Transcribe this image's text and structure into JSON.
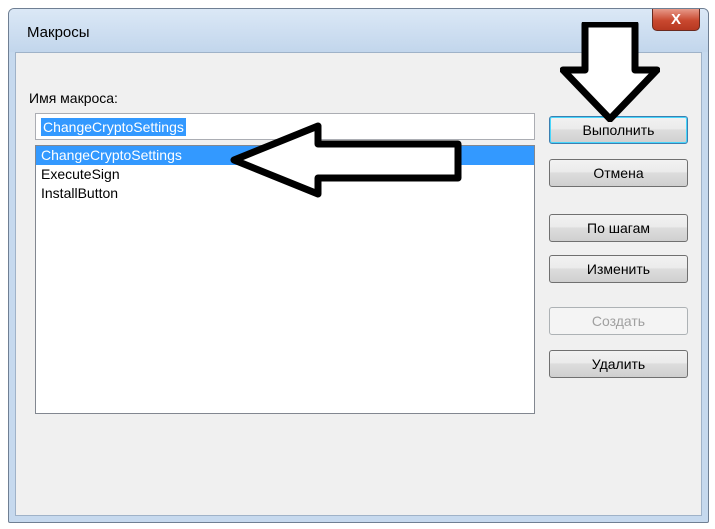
{
  "window": {
    "title": "Макросы",
    "close_glyph": "X"
  },
  "macro_name": {
    "label": "Имя макроса:",
    "value": "ChangeCryptoSettings"
  },
  "macros": [
    {
      "name": "ChangeCryptoSettings",
      "selected": true
    },
    {
      "name": "ExecuteSign",
      "selected": false
    },
    {
      "name": "InstallButton",
      "selected": false
    }
  ],
  "buttons": {
    "run": "Выполнить",
    "cancel": "Отмена",
    "step": "По шагам",
    "edit": "Изменить",
    "create": "Создать",
    "delete": "Удалить"
  },
  "colors": {
    "selection": "#3399ff",
    "title_bar": "#c6d9ee",
    "close_button": "#c9482f"
  },
  "annotations": [
    "down-arrow",
    "left-arrow"
  ]
}
